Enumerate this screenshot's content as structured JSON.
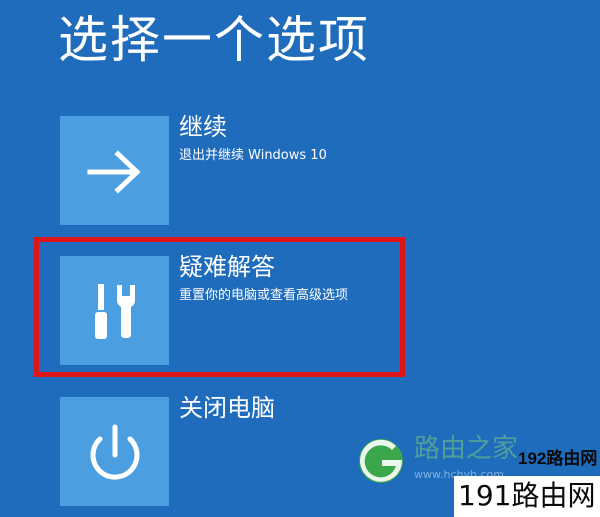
{
  "screen": {
    "title": "选择一个选项"
  },
  "options": [
    {
      "id": "continue",
      "icon": "arrow-right-icon",
      "label": "继续",
      "description": "退出并继续 Windows 10"
    },
    {
      "id": "troubleshoot",
      "icon": "screwdriver-wrench-icon",
      "label": "疑难解答",
      "description": "重置你的电脑或查看高级选项"
    },
    {
      "id": "shutdown",
      "icon": "power-icon",
      "label": "关闭电脑",
      "description": ""
    }
  ],
  "highlight": {
    "target": "troubleshoot",
    "color": "#e0151a"
  },
  "colors": {
    "background": "#1f6cbd",
    "tile": "#4b9fe0"
  },
  "watermark": {
    "faded_text": "路由之家",
    "url_text": "www.hchyh.com",
    "brand_192": "192路由网",
    "brand_191": "191路由网"
  }
}
